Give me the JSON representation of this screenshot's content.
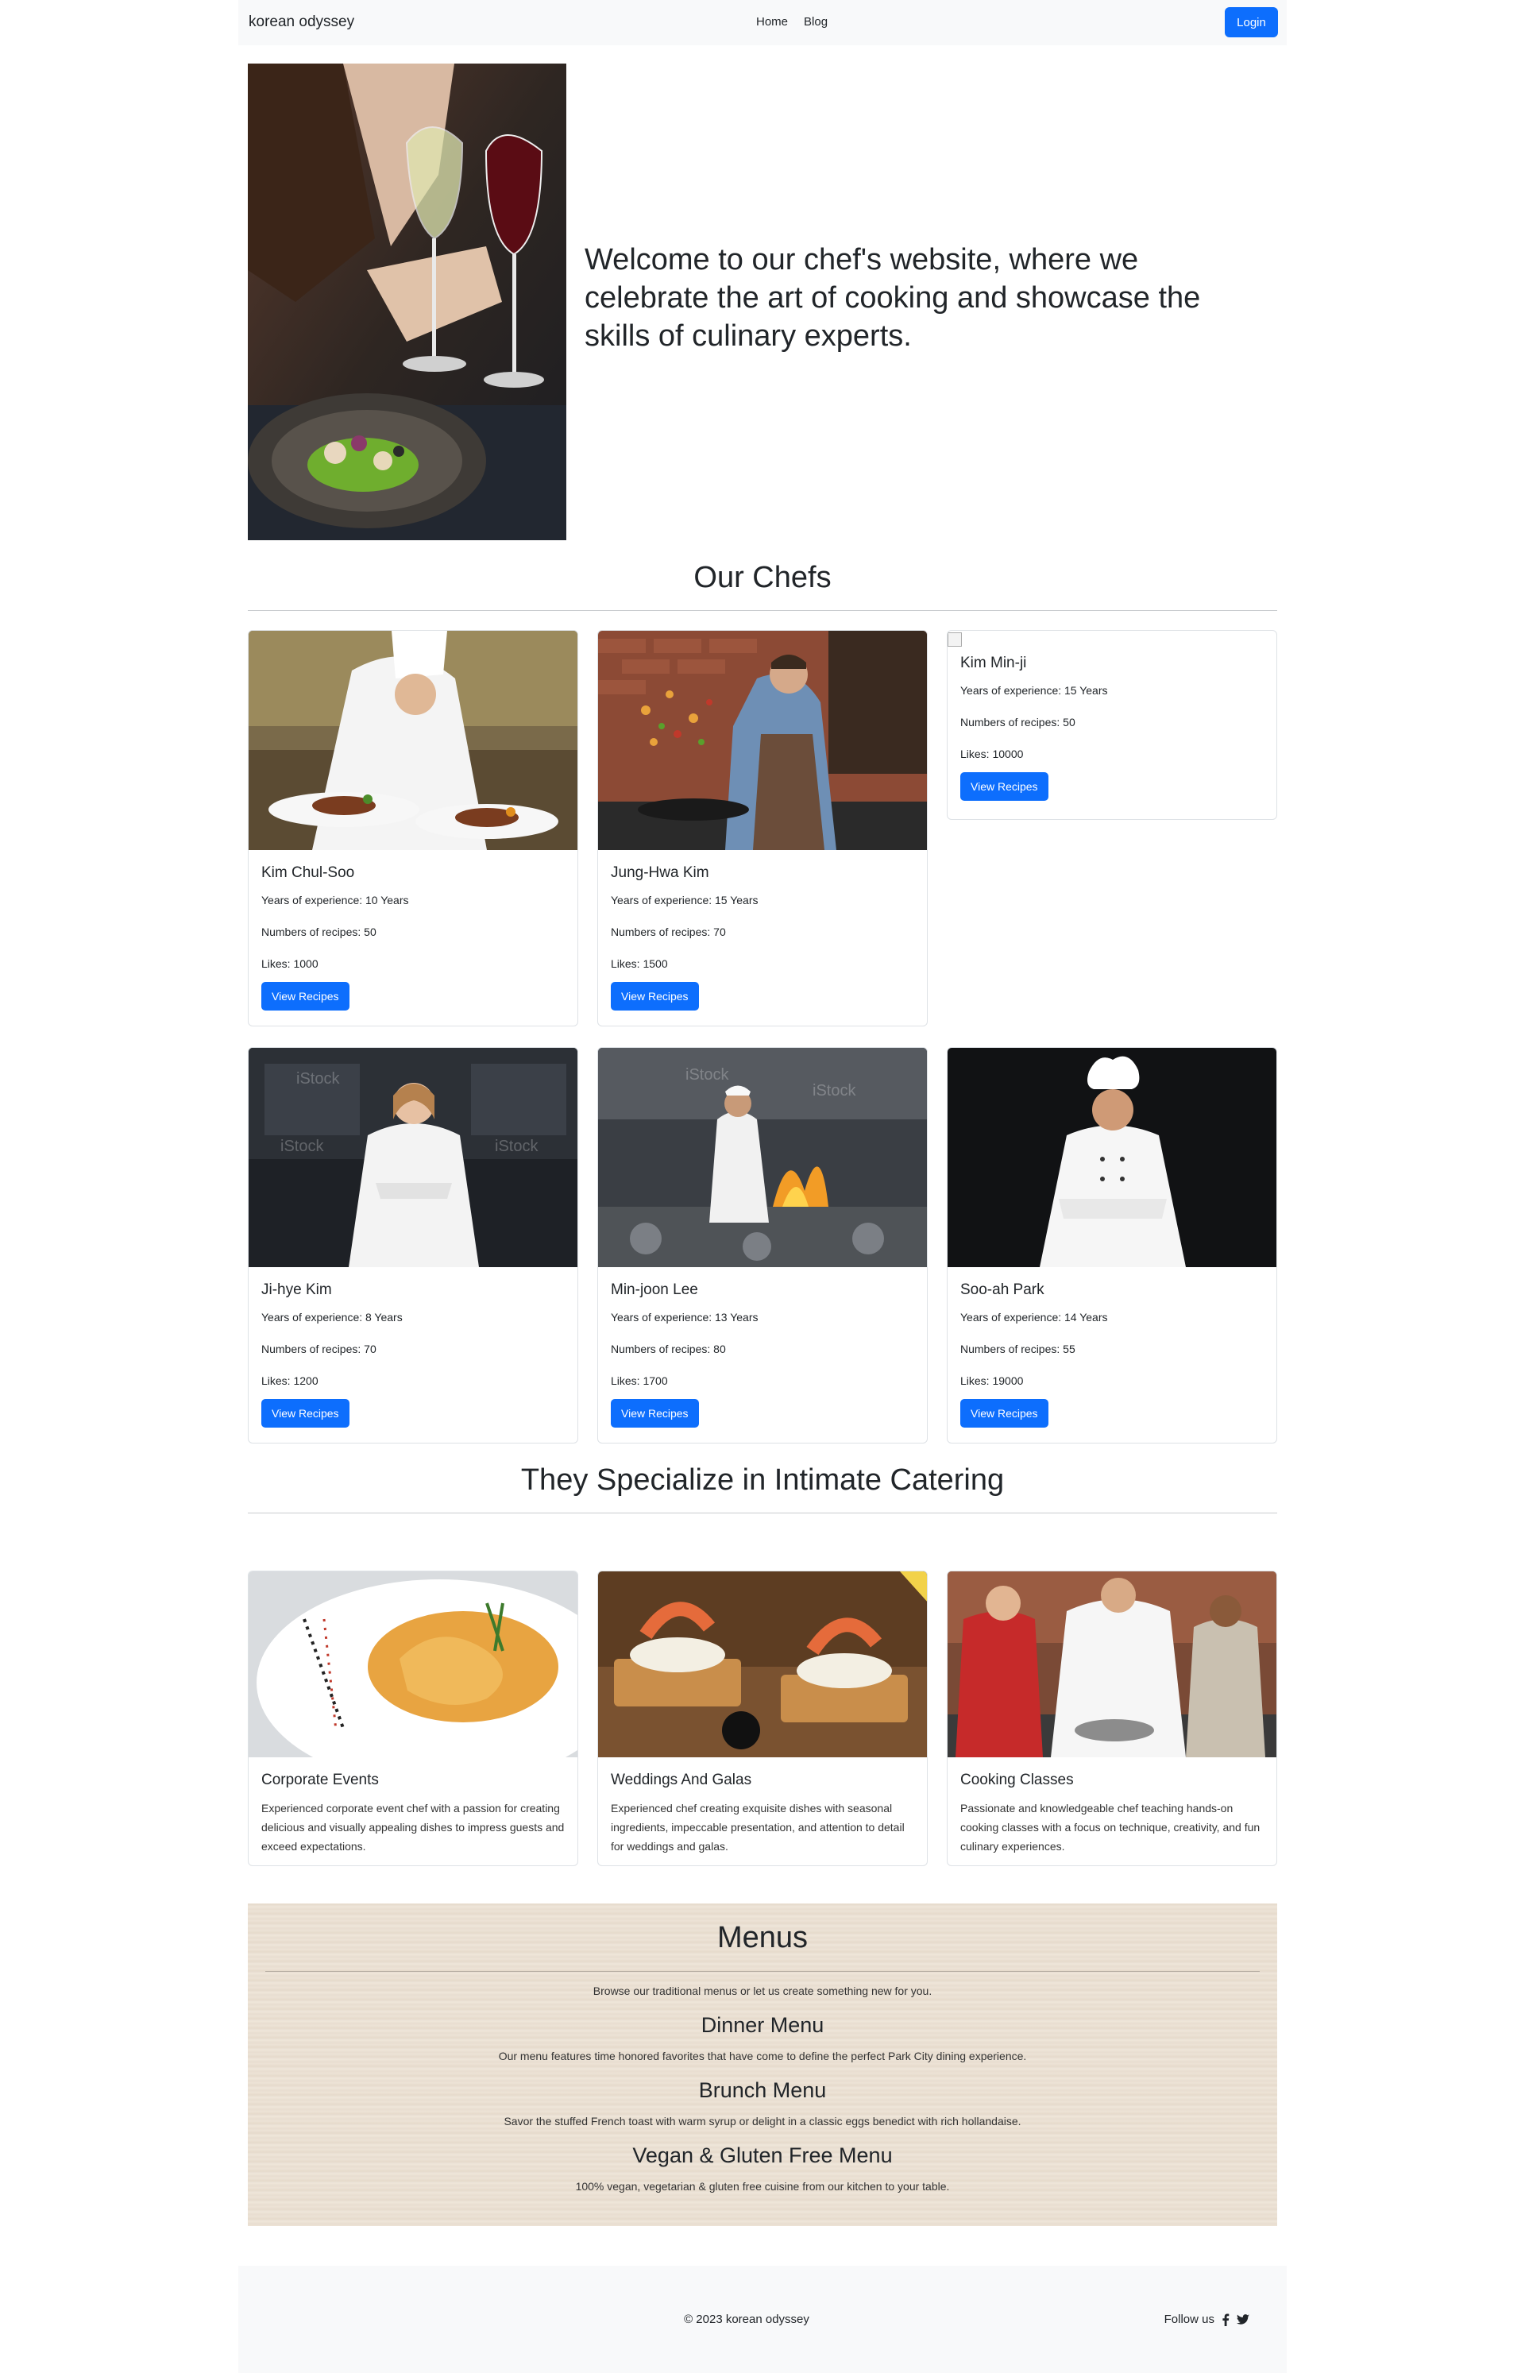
{
  "nav": {
    "brand": "korean odyssey",
    "links": [
      "Home",
      "Blog"
    ],
    "login": "Login"
  },
  "hero": {
    "text": "Welcome to our chef's website, where we celebrate the art of cooking and showcase the skills of culinary experts."
  },
  "chefs_section": {
    "title": "Our Chefs"
  },
  "chefs": [
    {
      "name": "Kim Chul-Soo",
      "experience": "Years of experience: 10 Years",
      "recipes": "Numbers of recipes: 50",
      "likes": "Likes: 1000",
      "button": "View Recipes"
    },
    {
      "name": "Jung-Hwa Kim",
      "experience": "Years of experience: 15 Years",
      "recipes": "Numbers of recipes: 70",
      "likes": "Likes: 1500",
      "button": "View Recipes"
    },
    {
      "name": "Kim Min-ji",
      "experience": "Years of experience: 15 Years",
      "recipes": "Numbers of recipes: 50",
      "likes": "Likes: 10000",
      "button": "View Recipes"
    },
    {
      "name": "Ji-hye Kim",
      "experience": "Years of experience: 8 Years",
      "recipes": "Numbers of recipes: 70",
      "likes": "Likes: 1200",
      "button": "View Recipes"
    },
    {
      "name": "Min-joon Lee",
      "experience": "Years of experience: 13 Years",
      "recipes": "Numbers of recipes: 80",
      "likes": "Likes: 1700",
      "button": "View Recipes"
    },
    {
      "name": "Soo-ah Park",
      "experience": "Years of experience: 14 Years",
      "recipes": "Numbers of recipes: 55",
      "likes": "Likes: 19000",
      "button": "View Recipes"
    }
  ],
  "catering": {
    "title": "They Specialize in Intimate Catering",
    "items": [
      {
        "title": "Corporate Events",
        "desc": "Experienced corporate event chef with a passion for creating delicious and visually appealing dishes to impress guests and exceed expectations."
      },
      {
        "title": "Weddings And Galas",
        "desc": "Experienced chef creating exquisite dishes with seasonal ingredients, impeccable presentation, and attention to detail for weddings and galas."
      },
      {
        "title": "Cooking Classes",
        "desc": "Passionate and knowledgeable chef teaching hands-on cooking classes with a focus on technique, creativity, and fun culinary experiences."
      }
    ]
  },
  "menus": {
    "title": "Menus",
    "subtitle": "Browse our traditional menus or let us create something new for you.",
    "items": [
      {
        "title": "Dinner Menu",
        "desc": "Our menu features time honored favorites that have come to define the perfect Park City dining experience."
      },
      {
        "title": "Brunch Menu",
        "desc": "Savor the stuffed French toast with warm syrup or delight in a classic eggs benedict with rich hollandaise."
      },
      {
        "title": "Vegan & Gluten Free Menu",
        "desc": "100% vegan, vegetarian & gluten free cuisine from our kitchen to your table."
      }
    ]
  },
  "footer": {
    "copyright": "© 2023 korean odyssey",
    "follow": "Follow us",
    "icons": [
      "facebook-icon",
      "twitter-icon"
    ]
  },
  "colors": {
    "primary": "#0d6efd",
    "navbar_bg": "#f8f9fa",
    "text": "#212529"
  }
}
